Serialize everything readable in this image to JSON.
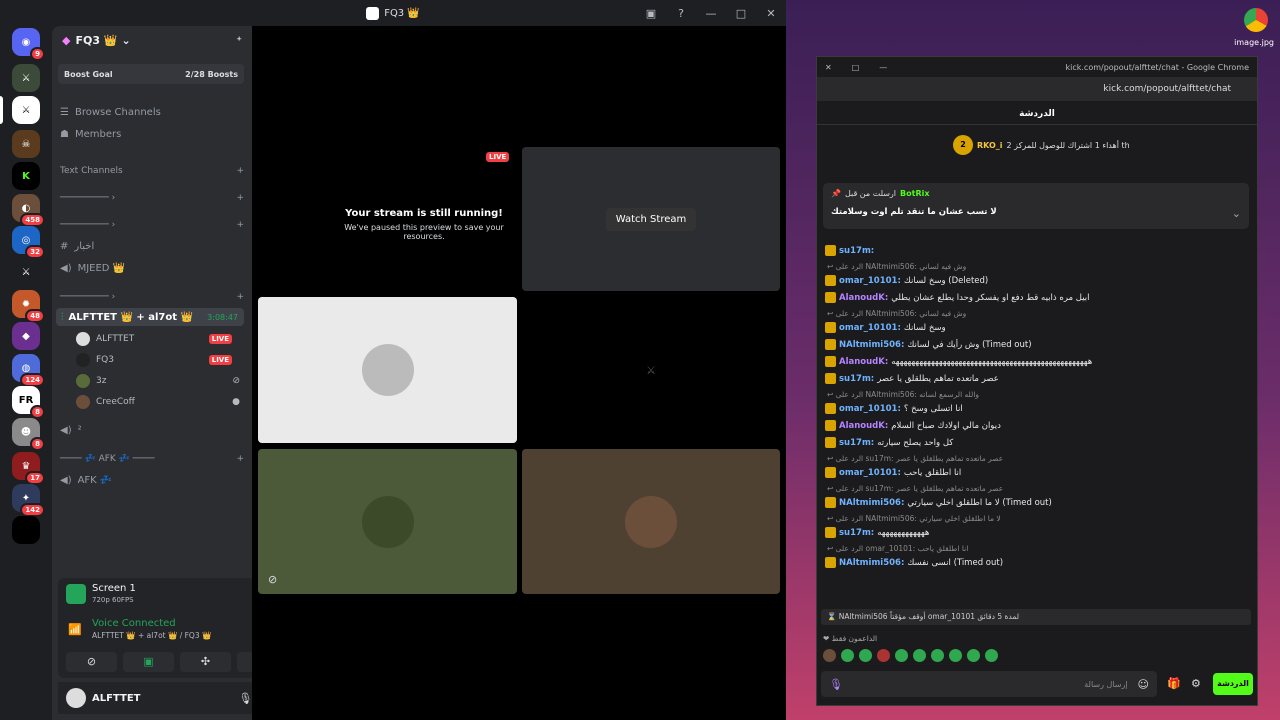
{
  "titlebar": {
    "title": "FQ3 👑"
  },
  "guilds": {
    "badges": [
      "9",
      "458",
      "32",
      "48",
      "124",
      "8",
      "8",
      "17",
      "142"
    ]
  },
  "sidebar": {
    "server_name": "FQ3 👑",
    "boost_label": "Boost Goal",
    "boost_count": "2/28 Boosts",
    "browse": "Browse Channels",
    "members": "Members",
    "cat_text": "Text Channels",
    "cat1": "───────── ›",
    "cat2": "───────── ›",
    "chan_akhbar": "اخبار",
    "chan_mjeed": "MJEED 👑",
    "cat3": "───────── ›",
    "voice_channel": "ALFTTET 👑 + al7ot 👑",
    "voice_time": "3:08:47",
    "users": [
      "ALFTTET",
      "FQ3",
      "3z",
      "CreeCoff"
    ],
    "live": "LIVE",
    "voice_small": "²",
    "cat_afk": "──── 💤 AFK 💤 ────",
    "afk": "AFK 💤"
  },
  "panel": {
    "screen": "Screen 1",
    "quality": "720p 60FPS",
    "status": "Voice Connected",
    "location": "ALFTTET 👑 + al7ot 👑 / FQ3 👑"
  },
  "user": {
    "name": "ALFTTET"
  },
  "stage": {
    "live": "LIVE",
    "paused_title": "Your stream is still running!",
    "paused_sub": "We've paused this preview to save your resources.",
    "watch": "Watch Stream"
  },
  "desktop": {
    "file": "image.jpg"
  },
  "chrome": {
    "title": "kick.com/popout/alfttet/chat - Google Chrome",
    "url": "kick.com/popout/alfttet/chat",
    "chat_header": "الدردشة",
    "top_user": "RKO_i",
    "top_rank": "2",
    "top_msg": "أهداء 1 اشتراك للوصول للمركز 2 th",
    "pin_label": "ارسلت من قبل",
    "pin_user": "BotRix",
    "pin_text": "لا تسب عشان ما تنقد تلم اوت وسلامتك",
    "messages": [
      {
        "kind": "msg",
        "user": "su17m",
        "text": "",
        "color": "#6fb3ff"
      },
      {
        "kind": "reply",
        "text": "↩ الرد على NAltmimi506: وش فيه لساني"
      },
      {
        "kind": "msg",
        "user": "omar_10101",
        "text": "وسخ لسانك (Deleted)",
        "color": "#6fb3ff"
      },
      {
        "kind": "msg",
        "user": "AlanoudK",
        "text": "ابيل مره ذابيه قط دفع او يفسكر وحدا يطلع عشان يطلي",
        "color": "#b583ff"
      },
      {
        "kind": "reply",
        "text": "↩ الرد على NAltmimi506: وش فيه لساني"
      },
      {
        "kind": "msg",
        "user": "omar_10101",
        "text": "وسخ لسانك",
        "color": "#6fb3ff"
      },
      {
        "kind": "msg",
        "user": "NAltmimi506",
        "text": "وش رأيك في لسانك (Timed out)",
        "color": "#6fb3ff"
      },
      {
        "kind": "msg",
        "user": "AlanoudK",
        "text": "ههههههههههههههههههههههههههههههههههههههههههههههههههه",
        "color": "#b583ff"
      },
      {
        "kind": "msg",
        "user": "su17m",
        "text": "عصر ماتعده تماهم يطلقلق يا عصر",
        "color": "#6fb3ff"
      },
      {
        "kind": "reply",
        "text": "↩ الرد على NAltmimi506: والله الرسمع لساته"
      },
      {
        "kind": "msg",
        "user": "omar_10101",
        "text": "انا اتسلى وسخ ؟",
        "color": "#6fb3ff"
      },
      {
        "kind": "msg",
        "user": "AlanoudK",
        "text": "ديوان مالي اولادك صباح السلام",
        "color": "#b583ff"
      },
      {
        "kind": "msg",
        "user": "su17m",
        "text": "كل واحد يصلح سيارته",
        "color": "#6fb3ff"
      },
      {
        "kind": "reply",
        "text": "↩ الرد على su17m: عصر ماتعده تماهم يطلقلق يا عصر"
      },
      {
        "kind": "msg",
        "user": "omar_10101",
        "text": "انا اطلقلق ياحب",
        "color": "#6fb3ff"
      },
      {
        "kind": "reply",
        "text": "↩ الرد على su17m: عصر ماتعده تماهم يطلقلق يا عصر"
      },
      {
        "kind": "msg",
        "user": "NAltmimi506",
        "text": "لا ما اطلقلق اخلي سيارتي (Timed out)",
        "color": "#6fb3ff"
      },
      {
        "kind": "reply",
        "text": "↩ الرد على NAltmimi506: لا ما اطلقلق اخلي سيارتي"
      },
      {
        "kind": "msg",
        "user": "su17m",
        "text": "ههههههههههههه",
        "color": "#6fb3ff"
      },
      {
        "kind": "reply",
        "text": "↩ الرد على omar_10101: انا اطلقلق ياحب"
      },
      {
        "kind": "msg",
        "user": "NAltmimi506",
        "text": "انسى نفسك (Timed out)",
        "color": "#6fb3ff"
      }
    ],
    "timeout_notice": "⌛ NAltmimi506 أوقف مؤقتاً omar_10101 لمدة 5 دقائق",
    "supporters": "❤ الداعمون فقط",
    "input_placeholder": "إرسال رسالة",
    "send": "الدردشة"
  }
}
